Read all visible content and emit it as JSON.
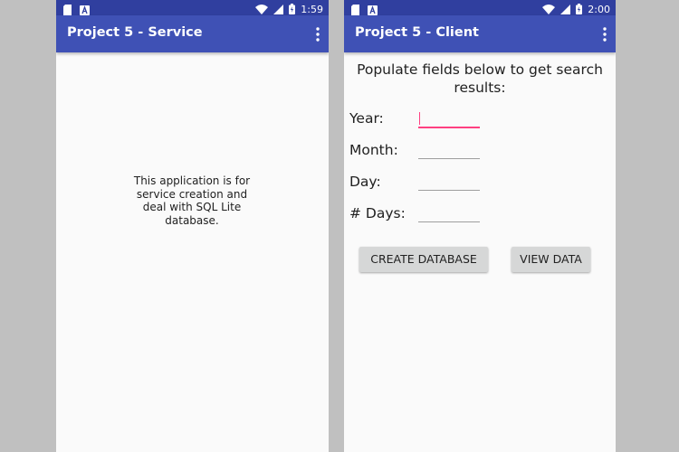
{
  "screens": {
    "service": {
      "status": {
        "time": "1:59"
      },
      "title": "Project 5 - Service",
      "body_text": "This application is for service creation and deal with SQL Lite database."
    },
    "client": {
      "status": {
        "time": "2:00"
      },
      "title": "Project 5 - Client",
      "intro": "Populate fields below to get search results:",
      "fields": [
        {
          "label": "Year:",
          "value": "",
          "focused": true
        },
        {
          "label": "Month:",
          "value": ""
        },
        {
          "label": "Day:",
          "value": ""
        },
        {
          "label": "# Days:",
          "value": ""
        }
      ],
      "buttons": {
        "create_label": "CREATE DATABASE",
        "view_label": "VIEW DATA"
      }
    }
  },
  "colors": {
    "status_bar": "#303f9f",
    "app_bar": "#3f51b5",
    "accent": "#ff4081",
    "button_bg": "#d6d7d7",
    "screen_bg": "#fafafa",
    "backdrop": "#c0c0c0"
  },
  "icons": {
    "status_left": [
      "sd-card-icon",
      "a-notification-icon"
    ],
    "status_right": [
      "wifi-icon",
      "signal-icon",
      "battery-icon"
    ],
    "app_bar": "overflow-menu-icon"
  }
}
